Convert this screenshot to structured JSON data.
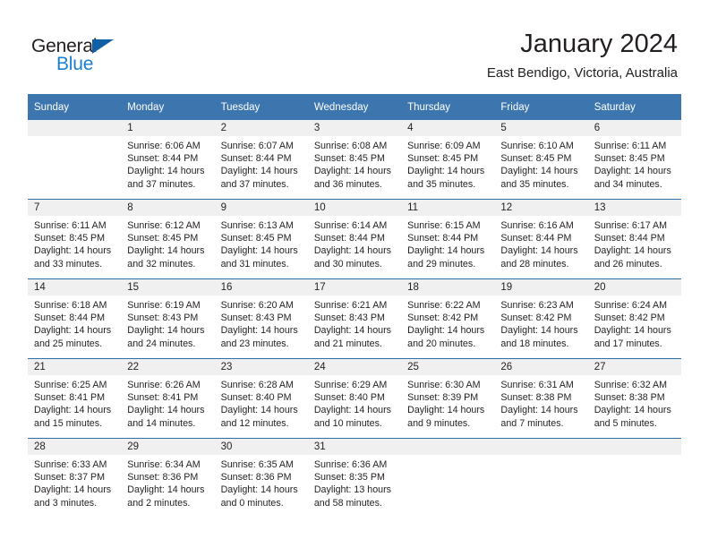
{
  "brand": {
    "name_part1": "General",
    "name_part2": "Blue",
    "accent_color": "#1b7fd4",
    "triangle_color": "#1060a8"
  },
  "header": {
    "title": "January 2024",
    "subtitle": "East Bendigo, Victoria, Australia"
  },
  "theme": {
    "header_row_color": "#3d76af",
    "row_divider_color": "#2f6da8",
    "daynum_band_color": "#f0f0f0",
    "text_color": "#231f20"
  },
  "calendar": {
    "weekday_headers": [
      "Sunday",
      "Monday",
      "Tuesday",
      "Wednesday",
      "Thursday",
      "Friday",
      "Saturday"
    ],
    "weeks": [
      [
        {
          "day": "",
          "empty": true,
          "sunrise": "",
          "sunset": "",
          "daylight_line1": "",
          "daylight_line2": ""
        },
        {
          "day": "1",
          "empty": false,
          "sunrise": "Sunrise: 6:06 AM",
          "sunset": "Sunset: 8:44 PM",
          "daylight_line1": "Daylight: 14 hours",
          "daylight_line2": "and 37 minutes."
        },
        {
          "day": "2",
          "empty": false,
          "sunrise": "Sunrise: 6:07 AM",
          "sunset": "Sunset: 8:44 PM",
          "daylight_line1": "Daylight: 14 hours",
          "daylight_line2": "and 37 minutes."
        },
        {
          "day": "3",
          "empty": false,
          "sunrise": "Sunrise: 6:08 AM",
          "sunset": "Sunset: 8:45 PM",
          "daylight_line1": "Daylight: 14 hours",
          "daylight_line2": "and 36 minutes."
        },
        {
          "day": "4",
          "empty": false,
          "sunrise": "Sunrise: 6:09 AM",
          "sunset": "Sunset: 8:45 PM",
          "daylight_line1": "Daylight: 14 hours",
          "daylight_line2": "and 35 minutes."
        },
        {
          "day": "5",
          "empty": false,
          "sunrise": "Sunrise: 6:10 AM",
          "sunset": "Sunset: 8:45 PM",
          "daylight_line1": "Daylight: 14 hours",
          "daylight_line2": "and 35 minutes."
        },
        {
          "day": "6",
          "empty": false,
          "sunrise": "Sunrise: 6:11 AM",
          "sunset": "Sunset: 8:45 PM",
          "daylight_line1": "Daylight: 14 hours",
          "daylight_line2": "and 34 minutes."
        }
      ],
      [
        {
          "day": "7",
          "empty": false,
          "sunrise": "Sunrise: 6:11 AM",
          "sunset": "Sunset: 8:45 PM",
          "daylight_line1": "Daylight: 14 hours",
          "daylight_line2": "and 33 minutes."
        },
        {
          "day": "8",
          "empty": false,
          "sunrise": "Sunrise: 6:12 AM",
          "sunset": "Sunset: 8:45 PM",
          "daylight_line1": "Daylight: 14 hours",
          "daylight_line2": "and 32 minutes."
        },
        {
          "day": "9",
          "empty": false,
          "sunrise": "Sunrise: 6:13 AM",
          "sunset": "Sunset: 8:45 PM",
          "daylight_line1": "Daylight: 14 hours",
          "daylight_line2": "and 31 minutes."
        },
        {
          "day": "10",
          "empty": false,
          "sunrise": "Sunrise: 6:14 AM",
          "sunset": "Sunset: 8:44 PM",
          "daylight_line1": "Daylight: 14 hours",
          "daylight_line2": "and 30 minutes."
        },
        {
          "day": "11",
          "empty": false,
          "sunrise": "Sunrise: 6:15 AM",
          "sunset": "Sunset: 8:44 PM",
          "daylight_line1": "Daylight: 14 hours",
          "daylight_line2": "and 29 minutes."
        },
        {
          "day": "12",
          "empty": false,
          "sunrise": "Sunrise: 6:16 AM",
          "sunset": "Sunset: 8:44 PM",
          "daylight_line1": "Daylight: 14 hours",
          "daylight_line2": "and 28 minutes."
        },
        {
          "day": "13",
          "empty": false,
          "sunrise": "Sunrise: 6:17 AM",
          "sunset": "Sunset: 8:44 PM",
          "daylight_line1": "Daylight: 14 hours",
          "daylight_line2": "and 26 minutes."
        }
      ],
      [
        {
          "day": "14",
          "empty": false,
          "sunrise": "Sunrise: 6:18 AM",
          "sunset": "Sunset: 8:44 PM",
          "daylight_line1": "Daylight: 14 hours",
          "daylight_line2": "and 25 minutes."
        },
        {
          "day": "15",
          "empty": false,
          "sunrise": "Sunrise: 6:19 AM",
          "sunset": "Sunset: 8:43 PM",
          "daylight_line1": "Daylight: 14 hours",
          "daylight_line2": "and 24 minutes."
        },
        {
          "day": "16",
          "empty": false,
          "sunrise": "Sunrise: 6:20 AM",
          "sunset": "Sunset: 8:43 PM",
          "daylight_line1": "Daylight: 14 hours",
          "daylight_line2": "and 23 minutes."
        },
        {
          "day": "17",
          "empty": false,
          "sunrise": "Sunrise: 6:21 AM",
          "sunset": "Sunset: 8:43 PM",
          "daylight_line1": "Daylight: 14 hours",
          "daylight_line2": "and 21 minutes."
        },
        {
          "day": "18",
          "empty": false,
          "sunrise": "Sunrise: 6:22 AM",
          "sunset": "Sunset: 8:42 PM",
          "daylight_line1": "Daylight: 14 hours",
          "daylight_line2": "and 20 minutes."
        },
        {
          "day": "19",
          "empty": false,
          "sunrise": "Sunrise: 6:23 AM",
          "sunset": "Sunset: 8:42 PM",
          "daylight_line1": "Daylight: 14 hours",
          "daylight_line2": "and 18 minutes."
        },
        {
          "day": "20",
          "empty": false,
          "sunrise": "Sunrise: 6:24 AM",
          "sunset": "Sunset: 8:42 PM",
          "daylight_line1": "Daylight: 14 hours",
          "daylight_line2": "and 17 minutes."
        }
      ],
      [
        {
          "day": "21",
          "empty": false,
          "sunrise": "Sunrise: 6:25 AM",
          "sunset": "Sunset: 8:41 PM",
          "daylight_line1": "Daylight: 14 hours",
          "daylight_line2": "and 15 minutes."
        },
        {
          "day": "22",
          "empty": false,
          "sunrise": "Sunrise: 6:26 AM",
          "sunset": "Sunset: 8:41 PM",
          "daylight_line1": "Daylight: 14 hours",
          "daylight_line2": "and 14 minutes."
        },
        {
          "day": "23",
          "empty": false,
          "sunrise": "Sunrise: 6:28 AM",
          "sunset": "Sunset: 8:40 PM",
          "daylight_line1": "Daylight: 14 hours",
          "daylight_line2": "and 12 minutes."
        },
        {
          "day": "24",
          "empty": false,
          "sunrise": "Sunrise: 6:29 AM",
          "sunset": "Sunset: 8:40 PM",
          "daylight_line1": "Daylight: 14 hours",
          "daylight_line2": "and 10 minutes."
        },
        {
          "day": "25",
          "empty": false,
          "sunrise": "Sunrise: 6:30 AM",
          "sunset": "Sunset: 8:39 PM",
          "daylight_line1": "Daylight: 14 hours",
          "daylight_line2": "and 9 minutes."
        },
        {
          "day": "26",
          "empty": false,
          "sunrise": "Sunrise: 6:31 AM",
          "sunset": "Sunset: 8:38 PM",
          "daylight_line1": "Daylight: 14 hours",
          "daylight_line2": "and 7 minutes."
        },
        {
          "day": "27",
          "empty": false,
          "sunrise": "Sunrise: 6:32 AM",
          "sunset": "Sunset: 8:38 PM",
          "daylight_line1": "Daylight: 14 hours",
          "daylight_line2": "and 5 minutes."
        }
      ],
      [
        {
          "day": "28",
          "empty": false,
          "sunrise": "Sunrise: 6:33 AM",
          "sunset": "Sunset: 8:37 PM",
          "daylight_line1": "Daylight: 14 hours",
          "daylight_line2": "and 3 minutes."
        },
        {
          "day": "29",
          "empty": false,
          "sunrise": "Sunrise: 6:34 AM",
          "sunset": "Sunset: 8:36 PM",
          "daylight_line1": "Daylight: 14 hours",
          "daylight_line2": "and 2 minutes."
        },
        {
          "day": "30",
          "empty": false,
          "sunrise": "Sunrise: 6:35 AM",
          "sunset": "Sunset: 8:36 PM",
          "daylight_line1": "Daylight: 14 hours",
          "daylight_line2": "and 0 minutes."
        },
        {
          "day": "31",
          "empty": false,
          "sunrise": "Sunrise: 6:36 AM",
          "sunset": "Sunset: 8:35 PM",
          "daylight_line1": "Daylight: 13 hours",
          "daylight_line2": "and 58 minutes."
        },
        {
          "day": "",
          "empty": true,
          "sunrise": "",
          "sunset": "",
          "daylight_line1": "",
          "daylight_line2": ""
        },
        {
          "day": "",
          "empty": true,
          "sunrise": "",
          "sunset": "",
          "daylight_line1": "",
          "daylight_line2": ""
        },
        {
          "day": "",
          "empty": true,
          "sunrise": "",
          "sunset": "",
          "daylight_line1": "",
          "daylight_line2": ""
        }
      ]
    ]
  }
}
